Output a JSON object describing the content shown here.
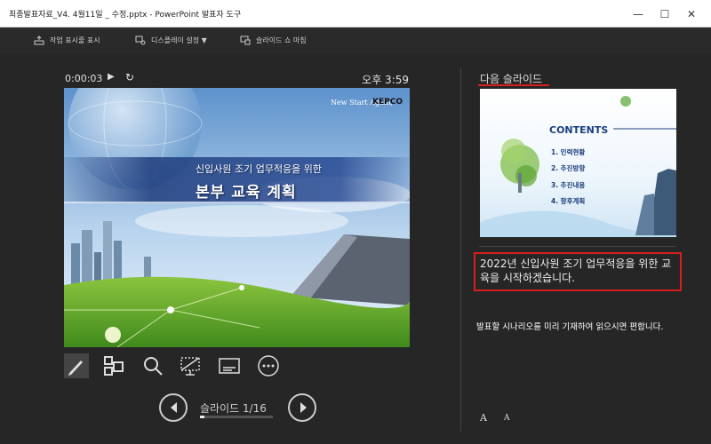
{
  "window": {
    "title": "최종발표자료_V4. 4월11일 _ 수정.pptx - PowerPoint 발표자 도구",
    "controls": {
      "minimize": "—",
      "maximize": "☐",
      "close": "✕"
    }
  },
  "toolbar": {
    "items": [
      {
        "label": "작업 표시줄 표시",
        "icon": "taskbar-icon"
      },
      {
        "label": "디스플레이 설정 ▼",
        "icon": "display-settings-icon"
      },
      {
        "label": "슬라이드 쇼 마침",
        "icon": "end-show-icon"
      }
    ]
  },
  "timer": {
    "elapsed": "0:00:03",
    "play": "▶",
    "reset": "↻",
    "clock": "오후 3:59"
  },
  "current_slide": {
    "tagline": "New Start Again,",
    "brand": "KEPCO",
    "subtitle": "신입사원 조기 업무적응을 위한",
    "title": "본부 교육 계획"
  },
  "tools": [
    "pen-icon",
    "slide-grid-icon",
    "zoom-icon",
    "black-screen-icon",
    "subtitles-icon",
    "more-options-icon"
  ],
  "navigation": {
    "slide_counter": "슬라이드 1/16",
    "progress": 0.0625
  },
  "next_slide": {
    "label": "다음 슬라이드",
    "heading": "CONTENTS",
    "items": [
      "1. 인력현황",
      "2. 추진방향",
      "3. 추진내용",
      "4. 향후계획"
    ]
  },
  "notes": {
    "text": "2022년 신입사원 조기 업무적응을 위한 교육을 시작하겠습니다.",
    "hint": "발표할 시나리오를 미리 기재하여 읽으시면 편합니다."
  },
  "font_controls": {
    "increase": "A",
    "decrease": "A"
  },
  "colors": {
    "highlight": "#d81e1e",
    "background": "#262626"
  }
}
